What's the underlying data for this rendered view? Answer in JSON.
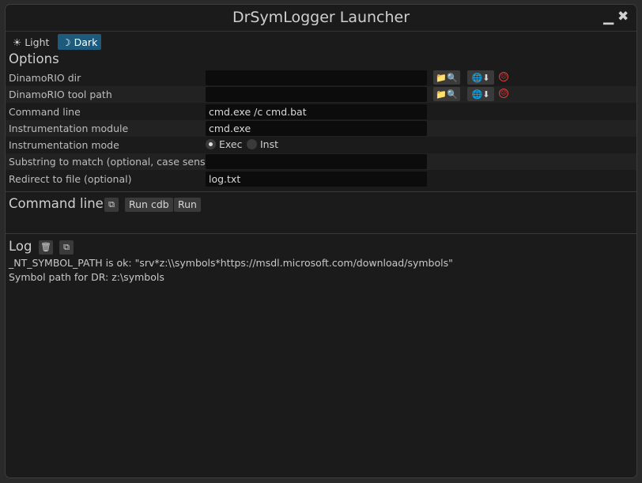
{
  "window": {
    "title": "DrSymLogger Launcher",
    "minimize_glyph": "▁",
    "close_glyph": "✖"
  },
  "theme": {
    "light_label": "Light",
    "dark_label": "Dark",
    "light_icon": "☀",
    "dark_icon": "☽",
    "selected": "Dark",
    "accent": "#1c5b7e"
  },
  "options": {
    "title": "Options",
    "rows": [
      {
        "label": "DinamoRIO dir",
        "value": "",
        "has_buttons": true,
        "status": "error"
      },
      {
        "label": "DinamoRIO tool path",
        "value": "",
        "has_buttons": true,
        "status": "error"
      },
      {
        "label": "Command line",
        "value": "cmd.exe /c cmd.bat"
      },
      {
        "label": "Instrumentation module",
        "value": "cmd.exe"
      },
      {
        "label": "Instrumentation mode",
        "radio": [
          "Exec",
          "Inst"
        ],
        "selected": "Exec"
      },
      {
        "label": "Substring to match (optional, case sensitive)",
        "value": ""
      },
      {
        "label": "Redirect to file (optional)",
        "value": "log.txt"
      }
    ],
    "browse_icons": "📁🔍",
    "download_icons": "🌐⬇",
    "status_icon": "sad-face-icon",
    "error_color": "#e23b3b"
  },
  "command_line": {
    "title": "Command line",
    "copy_icon": "⧉",
    "run_cdb_label": "Run cdb",
    "run_label": "Run"
  },
  "log": {
    "title": "Log",
    "trash_icon": "🗑",
    "copy_icon": "⧉",
    "lines": [
      "_NT_SYMBOL_PATH is ok: \"srv*z:\\\\symbols*https://msdl.microsoft.com/download/symbols\"",
      "Symbol path for DR: z:\\symbols"
    ]
  }
}
